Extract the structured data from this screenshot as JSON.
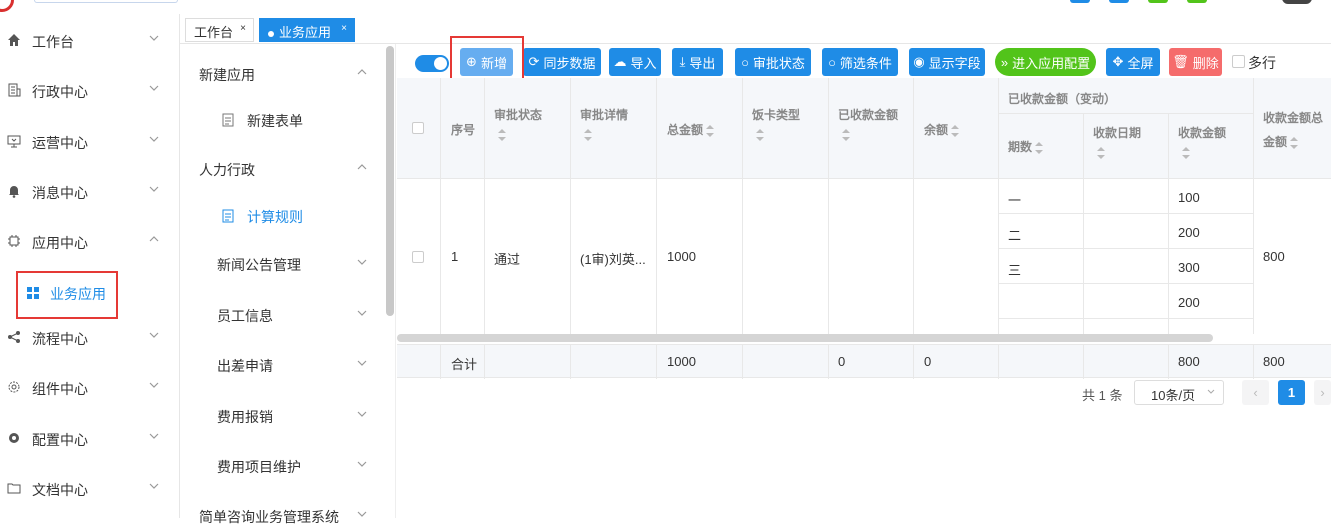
{
  "sidebar": {
    "items": [
      {
        "label": "工作台",
        "icon": "home-icon",
        "expanded": false
      },
      {
        "label": "行政中心",
        "icon": "building-icon",
        "expanded": false
      },
      {
        "label": "运营中心",
        "icon": "monitor-icon",
        "expanded": false
      },
      {
        "label": "消息中心",
        "icon": "bell-icon",
        "expanded": false
      },
      {
        "label": "应用中心",
        "icon": "chip-icon",
        "expanded": true
      },
      {
        "label": "流程中心",
        "icon": "share-icon",
        "expanded": false
      },
      {
        "label": "组件中心",
        "icon": "gear-outline-icon",
        "expanded": false
      },
      {
        "label": "配置中心",
        "icon": "gear-icon",
        "expanded": false
      },
      {
        "label": "文档中心",
        "icon": "folder-icon",
        "expanded": false
      }
    ],
    "active_sub": {
      "label": "业务应用",
      "icon": "grid-icon"
    }
  },
  "tabs": [
    {
      "label": "工作台",
      "close": "×"
    },
    {
      "label": "业务应用",
      "close": "×"
    }
  ],
  "subnav": {
    "groups": [
      {
        "label": "新建应用"
      },
      {
        "label": "人力行政"
      }
    ],
    "items": [
      {
        "label": "新建表单"
      },
      {
        "label": "计算规则"
      },
      {
        "label": "新闻公告管理"
      },
      {
        "label": "员工信息"
      },
      {
        "label": "出差申请"
      },
      {
        "label": "费用报销"
      },
      {
        "label": "费用项目维护"
      },
      {
        "label": "简单咨询业务管理系统"
      }
    ]
  },
  "toolbar": {
    "add": "新增",
    "sync": "同步数据",
    "import": "导入",
    "export": "导出",
    "approval_status": "审批状态",
    "filter": "筛选条件",
    "show_fields": "显示字段",
    "enter_config": "进入应用配置",
    "fullscreen": "全屏",
    "delete": "删除",
    "multi": "多行"
  },
  "table": {
    "headers": {
      "seq": "序号",
      "approval_status": "审批状态",
      "approval_detail": "审批详情",
      "total": "总金额",
      "meal_card": "饭卡类型",
      "received": "已收款金额",
      "balance": "余额",
      "received_change": "已收款金额（变动）",
      "period": "期数",
      "receive_date": "收款日期",
      "receive_amount": "收款金额",
      "receive_total": "收款金额总金额"
    },
    "row": {
      "seq": "1",
      "approval_status": "通过",
      "approval_detail": "(1审)刘英...",
      "total": "1000",
      "periods": [
        "一",
        "二",
        "三",
        ""
      ],
      "amounts": [
        "100",
        "200",
        "300",
        "200"
      ],
      "receive_total": "800"
    },
    "summary": {
      "label": "合计",
      "total": "1000",
      "received": "0",
      "balance": "0",
      "receive_amount": "800",
      "receive_total": "800"
    }
  },
  "pager": {
    "total": "共 1 条",
    "page_size": "10条/页",
    "current": "1",
    "prev": "‹",
    "next": "›"
  },
  "colors": {
    "primary": "#1f8ce6",
    "green": "#52c41a",
    "danger": "#f56c6c",
    "highlight": "#e53935"
  }
}
